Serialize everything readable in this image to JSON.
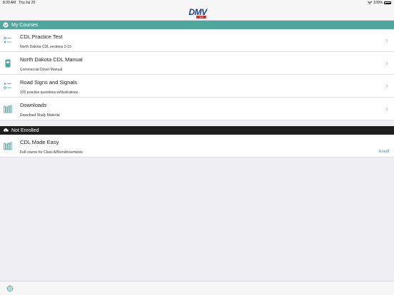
{
  "status_bar": {
    "time": "8:39 AM",
    "date": "Thu Jul 25",
    "battery": "100%"
  },
  "header": {
    "logo_text": "DMV",
    "logo_subtext": "test"
  },
  "sections": {
    "my_courses": {
      "label": "My Courses",
      "icon": "check-circle-icon"
    },
    "not_enrolled": {
      "label": "Not Enrolled",
      "icon": "cloud-download-icon"
    }
  },
  "courses": [
    {
      "title": "CDL Practice Test",
      "subtitle": "North Dakota CDL sections 2-10",
      "icon": "checklist-icon"
    },
    {
      "title": "North Dakota CDL Manual",
      "subtitle": "Commercial Driver Manual",
      "icon": "book-icon"
    },
    {
      "title": "Road Signs and Signals",
      "subtitle": "120 practice questions w/illustrations",
      "icon": "checklist-icon"
    },
    {
      "title": "Downloads",
      "subtitle": "Download Study Material",
      "icon": "library-icon"
    }
  ],
  "not_enrolled_courses": [
    {
      "title": "CDL Made Easy",
      "subtitle": "Full course for Class A/B/endorsements",
      "action": "Enroll",
      "icon": "library-icon"
    }
  ],
  "colors": {
    "accent": "#4ea79c",
    "dark_header": "#1f1f1f",
    "link": "#2a7fd4",
    "logo_blue": "#1d3f8f"
  },
  "bottom_bar": {
    "icon": "settings-icon"
  }
}
